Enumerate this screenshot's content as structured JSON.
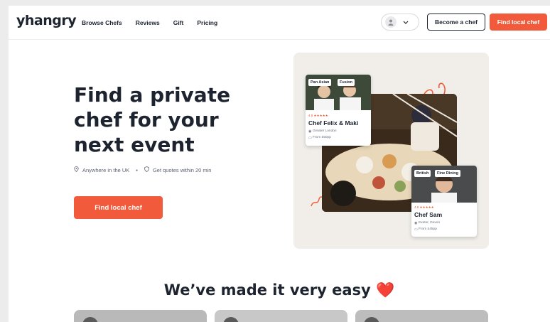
{
  "header": {
    "logo": "yhangry",
    "nav": [
      "Browse Chefs",
      "Reviews",
      "Gift",
      "Pricing"
    ],
    "become_chef": "Become a chef",
    "find_chef": "Find local chef"
  },
  "hero": {
    "title": "Find a private chef for your next event",
    "meta_location": "Anywhere in the UK",
    "meta_separator": "•",
    "meta_quotes": "Get quotes within 20 min",
    "cta": "Find local chef"
  },
  "cards": [
    {
      "tags": [
        "Pan Asian",
        "Fusion"
      ],
      "rating": "4.9 ★★★★★",
      "name": "Chef Felix & Maki",
      "location": "Greater London",
      "price": "From £50pp"
    },
    {
      "tags": [
        "British",
        "Fine Dining"
      ],
      "rating": "4.9 ★★★★★",
      "name": "Chef Sam",
      "location": "Exeter, Devon",
      "price": "From £45pp"
    }
  ],
  "section": {
    "title": "We’ve made it very easy ❤️"
  },
  "colors": {
    "accent": "#f15a3a",
    "text": "#1d2430",
    "panel_bg": "#f1eee9"
  }
}
